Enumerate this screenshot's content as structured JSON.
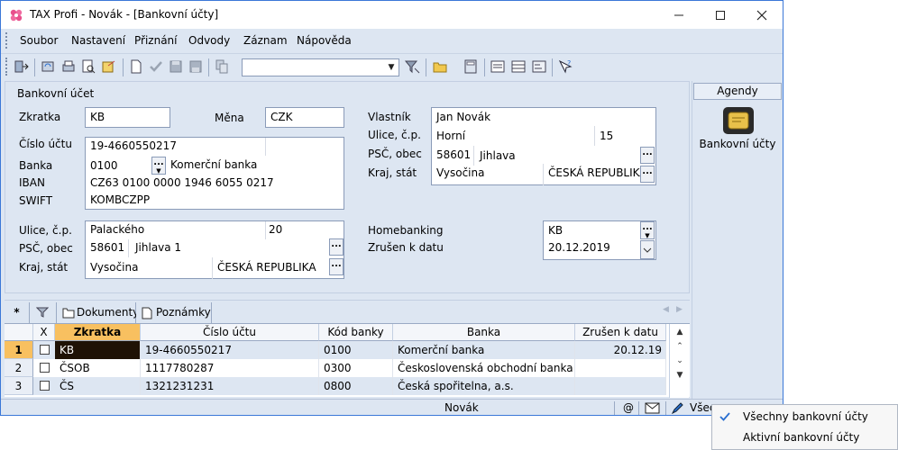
{
  "window": {
    "title": "TAX Profi - Novák - [Bankovní účty]"
  },
  "menu": [
    "Soubor",
    "Nastavení",
    "Přiznání",
    "Odvody",
    "Záznam",
    "Nápověda"
  ],
  "form": {
    "section_title": "Bankovní účet",
    "zkratka": {
      "label": "Zkratka",
      "value": "KB"
    },
    "mena": {
      "label": "Měna",
      "value": "CZK"
    },
    "cislo_uctu": {
      "label": "Číslo účtu",
      "value": "19-4660550217"
    },
    "banka": {
      "label": "Banka",
      "code": "0100",
      "name": "Komerční banka"
    },
    "iban": {
      "label": "IBAN",
      "value": "CZ63 0100 0000 1946 6055 0217"
    },
    "swift": {
      "label": "SWIFT",
      "value": "KOMBCZPP"
    },
    "bank_address": {
      "ulice_label": "Ulice, č.p.",
      "ulice": "Palackého",
      "cislo": "20",
      "psc_label": "PSČ, obec",
      "psc": "58601",
      "obec": "Jihlava 1",
      "kraj_label": "Kraj, stát",
      "kraj": "Vysočina",
      "stat": "ČESKÁ REPUBLIKA"
    },
    "owner": {
      "vlastnik_label": "Vlastník",
      "vlastnik": "Jan Novák",
      "ulice_label": "Ulice, č.p.",
      "ulice": "Horní",
      "cislo": "15",
      "psc_label": "PSČ, obec",
      "psc": "58601",
      "obec": "Jihlava",
      "kraj_label": "Kraj, stát",
      "kraj": "Vysočina",
      "stat": "ČESKÁ REPUBLIKA"
    },
    "homebanking": {
      "label": "Homebanking",
      "value": "KB"
    },
    "zrusen": {
      "label": "Zrušen k datu",
      "value": "20.12.2019"
    },
    "dots": "..."
  },
  "agendy": {
    "header": "Agendy",
    "item_label": "Bankovní účty"
  },
  "tabs": {
    "star": "*",
    "dokumenty": "Dokumenty",
    "poznamky": "Poznámky"
  },
  "grid": {
    "columns": [
      "X",
      "Zkratka",
      "Číslo účtu",
      "Kód banky",
      "Banka",
      "Zrušen k datu"
    ],
    "rows": [
      {
        "num": "1",
        "zkratka": "KB",
        "cislo": "19-4660550217",
        "kod": "0100",
        "banka": "Komerční banka",
        "zrusen": "20.12.19"
      },
      {
        "num": "2",
        "zkratka": "ČSOB",
        "cislo": "1117780287",
        "kod": "0300",
        "banka": "Československá obchodní banka",
        "zrusen": ""
      },
      {
        "num": "3",
        "zkratka": "ČS",
        "cislo": "1321231231",
        "kod": "0800",
        "banka": "Česká spořitelna, a.s.",
        "zrusen": ""
      }
    ]
  },
  "status": {
    "user": "Novák",
    "at": "@",
    "filter_partial": "Všec"
  },
  "popup": {
    "items": [
      "Všechny bankovní účty",
      "Aktivní bankovní účty"
    ]
  },
  "colors": {
    "selected_row": "#1f1205",
    "header_active": "#f8c060",
    "accent": "#3b78d8"
  }
}
